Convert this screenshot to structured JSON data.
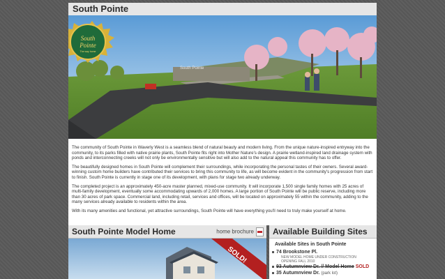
{
  "header": {
    "title": "South Pointe"
  },
  "logo": {
    "line1": "South",
    "line2": "Pointe",
    "tagline": "The way home"
  },
  "hero": {
    "sign_text": "South Pointe"
  },
  "intro_paragraphs": [
    "The community of South Pointe in Waverly West is a seamless blend of natural beauty and modern living. From the unique nature-inspired entryway into the community, to its parks filled with native prairie plants, South Pointe fits right into Mother Nature's design. A prairie wetland-inspired land drainage system with ponds and interconnecting creeks will not only be environmentally sensitive but will also add to the natural appeal this community has to offer.",
    "The beautifully designed homes in South Pointe will complement their surroundings, while incorporating the personal tastes of their owners. Several award-winning custom home builders have contributed their services to bring this community to life, as will become evident in the community's progression from start to finish. South Pointe is currently in stage one of its development, with plans for stage two already underway.",
    "The completed project is an approximately 450-acre master planned, mixed-use community. It will incorporate 1,500 single family homes with 25 acres of multi-family development, eventually some accommodating upwards of 2,000 homes. A large portion of South Pointe will be public reserve, including more than 30 acres of park space. Commercial land, including retail, services and offices, will be located on approximately 55 within the community, adding to the many services already available to residents within the area.",
    "With its many amenities and functional, yet attractive surroundings, South Pointe will have everything you'll need to truly make yourself at home."
  ],
  "model_home": {
    "title": "South Pointe Model Home",
    "brochure_label": "home brochure",
    "sold_banner": "SOLD!"
  },
  "building_sites": {
    "title": "Available Building Sites",
    "subtitle": "Available Sites in South Pointe",
    "items": [
      {
        "address": "74 Brookstone Pl.",
        "note": "NEW MODEL HOME UNDER CONSTRUCTION",
        "note2": "OPENING FALL 2010"
      },
      {
        "address": "93 Autumnview Dr. // Model Home",
        "status": "SOLD"
      },
      {
        "address": "35 Autumnview Dr.",
        "lot": "(park lot)"
      }
    ]
  },
  "colors": {
    "sold_red": "#b32020",
    "sign_green": "#1f6b3a",
    "sign_gold": "#d8b23a"
  }
}
